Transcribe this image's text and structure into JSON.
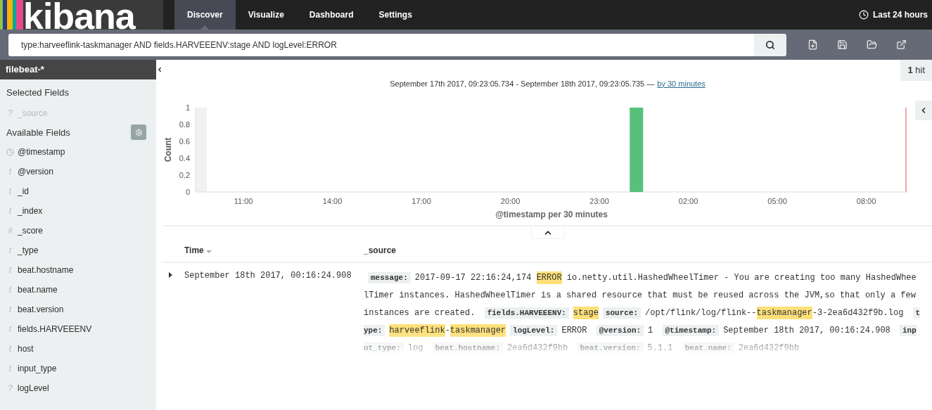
{
  "app": {
    "logo": "kibana"
  },
  "nav_tabs": [
    {
      "label": "Discover",
      "selected": true
    },
    {
      "label": "Visualize",
      "selected": false
    },
    {
      "label": "Dashboard",
      "selected": false
    },
    {
      "label": "Settings",
      "selected": false
    }
  ],
  "time_picker": {
    "label": "Last 24 hours"
  },
  "query": {
    "value": "type:harveeflink-taskmanager AND fields.HARVEEENV:stage AND logLevel:ERROR"
  },
  "sidebar": {
    "index_pattern": "filebeat-*",
    "selected_title": "Selected Fields",
    "selected_fields": [
      {
        "kind": "glyph",
        "glyph": "?",
        "name": "_source"
      }
    ],
    "available_title": "Available Fields",
    "available_fields": [
      {
        "kind": "date",
        "name": "@timestamp"
      },
      {
        "kind": "glyph",
        "glyph": "t",
        "name": "@version"
      },
      {
        "kind": "glyph",
        "glyph": "t",
        "name": "_id"
      },
      {
        "kind": "glyph",
        "glyph": "t",
        "name": "_index"
      },
      {
        "kind": "glyph",
        "glyph": "#",
        "name": "_score"
      },
      {
        "kind": "glyph",
        "glyph": "t",
        "name": "_type"
      },
      {
        "kind": "glyph",
        "glyph": "t",
        "name": "beat.hostname"
      },
      {
        "kind": "glyph",
        "glyph": "t",
        "name": "beat.name"
      },
      {
        "kind": "glyph",
        "glyph": "t",
        "name": "beat.version"
      },
      {
        "kind": "glyph",
        "glyph": "t",
        "name": "fields.HARVEEENV"
      },
      {
        "kind": "glyph",
        "glyph": "t",
        "name": "host"
      },
      {
        "kind": "glyph",
        "glyph": "t",
        "name": "input_type"
      },
      {
        "kind": "glyph",
        "glyph": "?",
        "name": "logLevel"
      }
    ]
  },
  "hits": "**1** hit",
  "time_range": {
    "text": "September 17th 2017, 09:23:05.734 - September 18th 2017, 09:23:05.735 —",
    "interval": "by 30 minutes"
  },
  "histogram": {
    "chart_data": {
      "type": "bar",
      "ylabel": "Count",
      "xlabel": "@timestamp per 30 minutes",
      "categories": [
        null,
        null,
        null,
        null,
        "11:00",
        null,
        null,
        null,
        null,
        null,
        "14:00",
        null,
        null,
        null,
        null,
        null,
        "17:00",
        null,
        null,
        null,
        null,
        null,
        "20:00",
        null,
        null,
        null,
        null,
        null,
        "23:00",
        null,
        null,
        null,
        null,
        null,
        "02:00",
        null,
        null,
        null,
        null,
        null,
        "05:00",
        null,
        null,
        null,
        null,
        null,
        "08:00",
        null,
        null
      ],
      "series": [
        {
          "color": "#57c17b",
          "values": [
            null,
            null,
            null,
            null,
            null,
            null,
            null,
            null,
            null,
            null,
            null,
            null,
            null,
            null,
            null,
            null,
            null,
            null,
            null,
            null,
            null,
            null,
            null,
            null,
            null,
            null,
            null,
            null,
            null,
            null,
            1,
            null,
            null,
            null,
            null,
            null,
            null,
            null,
            null,
            null,
            null,
            null,
            null,
            null,
            null,
            null,
            null,
            null,
            null
          ]
        }
      ],
      "ylim": [
        0,
        1
      ],
      "yticks": [
        0,
        0.2,
        0.4,
        0.6,
        0.8,
        1
      ]
    }
  },
  "table": {
    "columns": [
      {
        "label": "Time",
        "sorted": true
      },
      {
        "label": "_source",
        "sorted": false
      }
    ],
    "rows": [
      {
        "expanded": false,
        "time": "September 18th 2017, 00:16:24.908",
        "source": [
          {
            "kind": "key",
            "text": "message:"
          },
          {
            "kind": "text",
            "text": "2017-09-17 22:16:24,174 "
          },
          {
            "kind": "highlight",
            "text": "ERROR"
          },
          {
            "kind": "text",
            "text": " io.netty.util.HashedWheelTimer - You are creating too many HashedWheelTimer instances. HashedWheelTimer is a shared resource that must be reused across the JVM,so that only a few instances are created. "
          },
          {
            "kind": "key",
            "text": "fields.HARVEEENV:"
          },
          {
            "kind": "highlight",
            "text": "stage"
          },
          {
            "kind": "key",
            "text": "source:"
          },
          {
            "kind": "text",
            "text": "/opt/flink/log/flink--"
          },
          {
            "kind": "highlight",
            "text": "taskmanager"
          },
          {
            "kind": "text",
            "text": "-3-2ea6d432f9b.log "
          },
          {
            "kind": "key",
            "text": "type:"
          },
          {
            "kind": "highlight",
            "text": "harveeflink"
          },
          {
            "kind": "text",
            "text": "-"
          },
          {
            "kind": "highlight",
            "text": "taskmanager"
          },
          {
            "kind": "key",
            "text": "logLevel:"
          },
          {
            "kind": "text",
            "text": "ERROR "
          },
          {
            "kind": "key",
            "text": "@version:"
          },
          {
            "kind": "text",
            "text": "1 "
          },
          {
            "kind": "key",
            "text": "@timestamp:"
          },
          {
            "kind": "text",
            "text": "September 18th 2017, 00:16:24.908 "
          },
          {
            "kind": "key",
            "text": "input_type:"
          },
          {
            "kind": "text",
            "text": "log "
          },
          {
            "kind": "key",
            "text": "beat.hostname:"
          },
          {
            "kind": "text",
            "text": "2ea6d432f9bb "
          },
          {
            "kind": "key",
            "text": "beat.version:"
          },
          {
            "kind": "text",
            "text": "5.1.1 "
          },
          {
            "kind": "key",
            "text": "beat.name:"
          },
          {
            "kind": "text",
            "text": "2ea6d432f9bb"
          }
        ]
      }
    ]
  }
}
